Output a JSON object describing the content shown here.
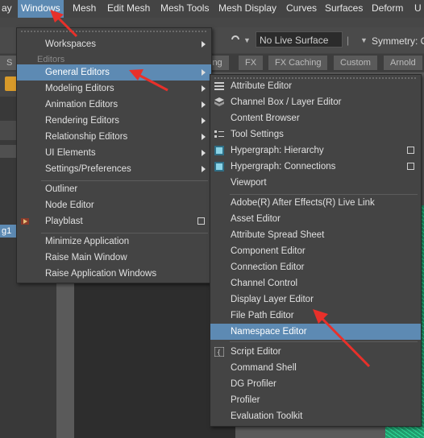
{
  "menubar": {
    "items": [
      "ay",
      "Windows",
      "Mesh",
      "Edit Mesh",
      "Mesh Tools",
      "Mesh Display",
      "Curves",
      "Surfaces",
      "Deform",
      "U"
    ]
  },
  "toolbar": {
    "live_surface": "No Live Surface",
    "symmetry": "Symmetry: O"
  },
  "shelf": {
    "tabs": [
      "S",
      "ing",
      "FX",
      "FX Caching",
      "Custom",
      "Arnold"
    ]
  },
  "outliner": {
    "selected": "g1"
  },
  "windows_menu": {
    "items": [
      {
        "label": "Workspaces"
      },
      {
        "section": "Editors"
      },
      {
        "label": "General Editors"
      },
      {
        "label": "Modeling Editors"
      },
      {
        "label": "Animation Editors"
      },
      {
        "label": "Rendering Editors"
      },
      {
        "label": "Relationship Editors"
      },
      {
        "label": "UI Elements"
      },
      {
        "label": "Settings/Preferences"
      },
      {
        "label": "Outliner"
      },
      {
        "label": "Node Editor"
      },
      {
        "label": "Playblast"
      },
      {
        "label": "Minimize Application"
      },
      {
        "label": "Raise Main Window"
      },
      {
        "label": "Raise Application Windows"
      }
    ]
  },
  "general_editors_menu": {
    "items": [
      {
        "label": "Attribute Editor"
      },
      {
        "label": "Channel Box / Layer Editor"
      },
      {
        "label": "Content Browser"
      },
      {
        "label": "Tool Settings"
      },
      {
        "label": "Hypergraph: Hierarchy"
      },
      {
        "label": "Hypergraph: Connections"
      },
      {
        "label": "Viewport"
      },
      {
        "label": "Adobe(R) After Effects(R) Live Link"
      },
      {
        "label": "Asset Editor"
      },
      {
        "label": "Attribute Spread Sheet"
      },
      {
        "label": "Component Editor"
      },
      {
        "label": "Connection Editor"
      },
      {
        "label": "Channel Control"
      },
      {
        "label": "Display Layer Editor"
      },
      {
        "label": "File Path Editor"
      },
      {
        "label": "Namespace Editor"
      },
      {
        "label": "Script Editor"
      },
      {
        "label": "Command Shell"
      },
      {
        "label": "DG Profiler"
      },
      {
        "label": "Profiler"
      },
      {
        "label": "Evaluation Toolkit"
      }
    ]
  },
  "colors": {
    "highlight": "#5d8ab3",
    "menu_bg": "#444444",
    "annotation_arrow": "#e8302a",
    "mesh_wire": "#2fdc9a"
  }
}
